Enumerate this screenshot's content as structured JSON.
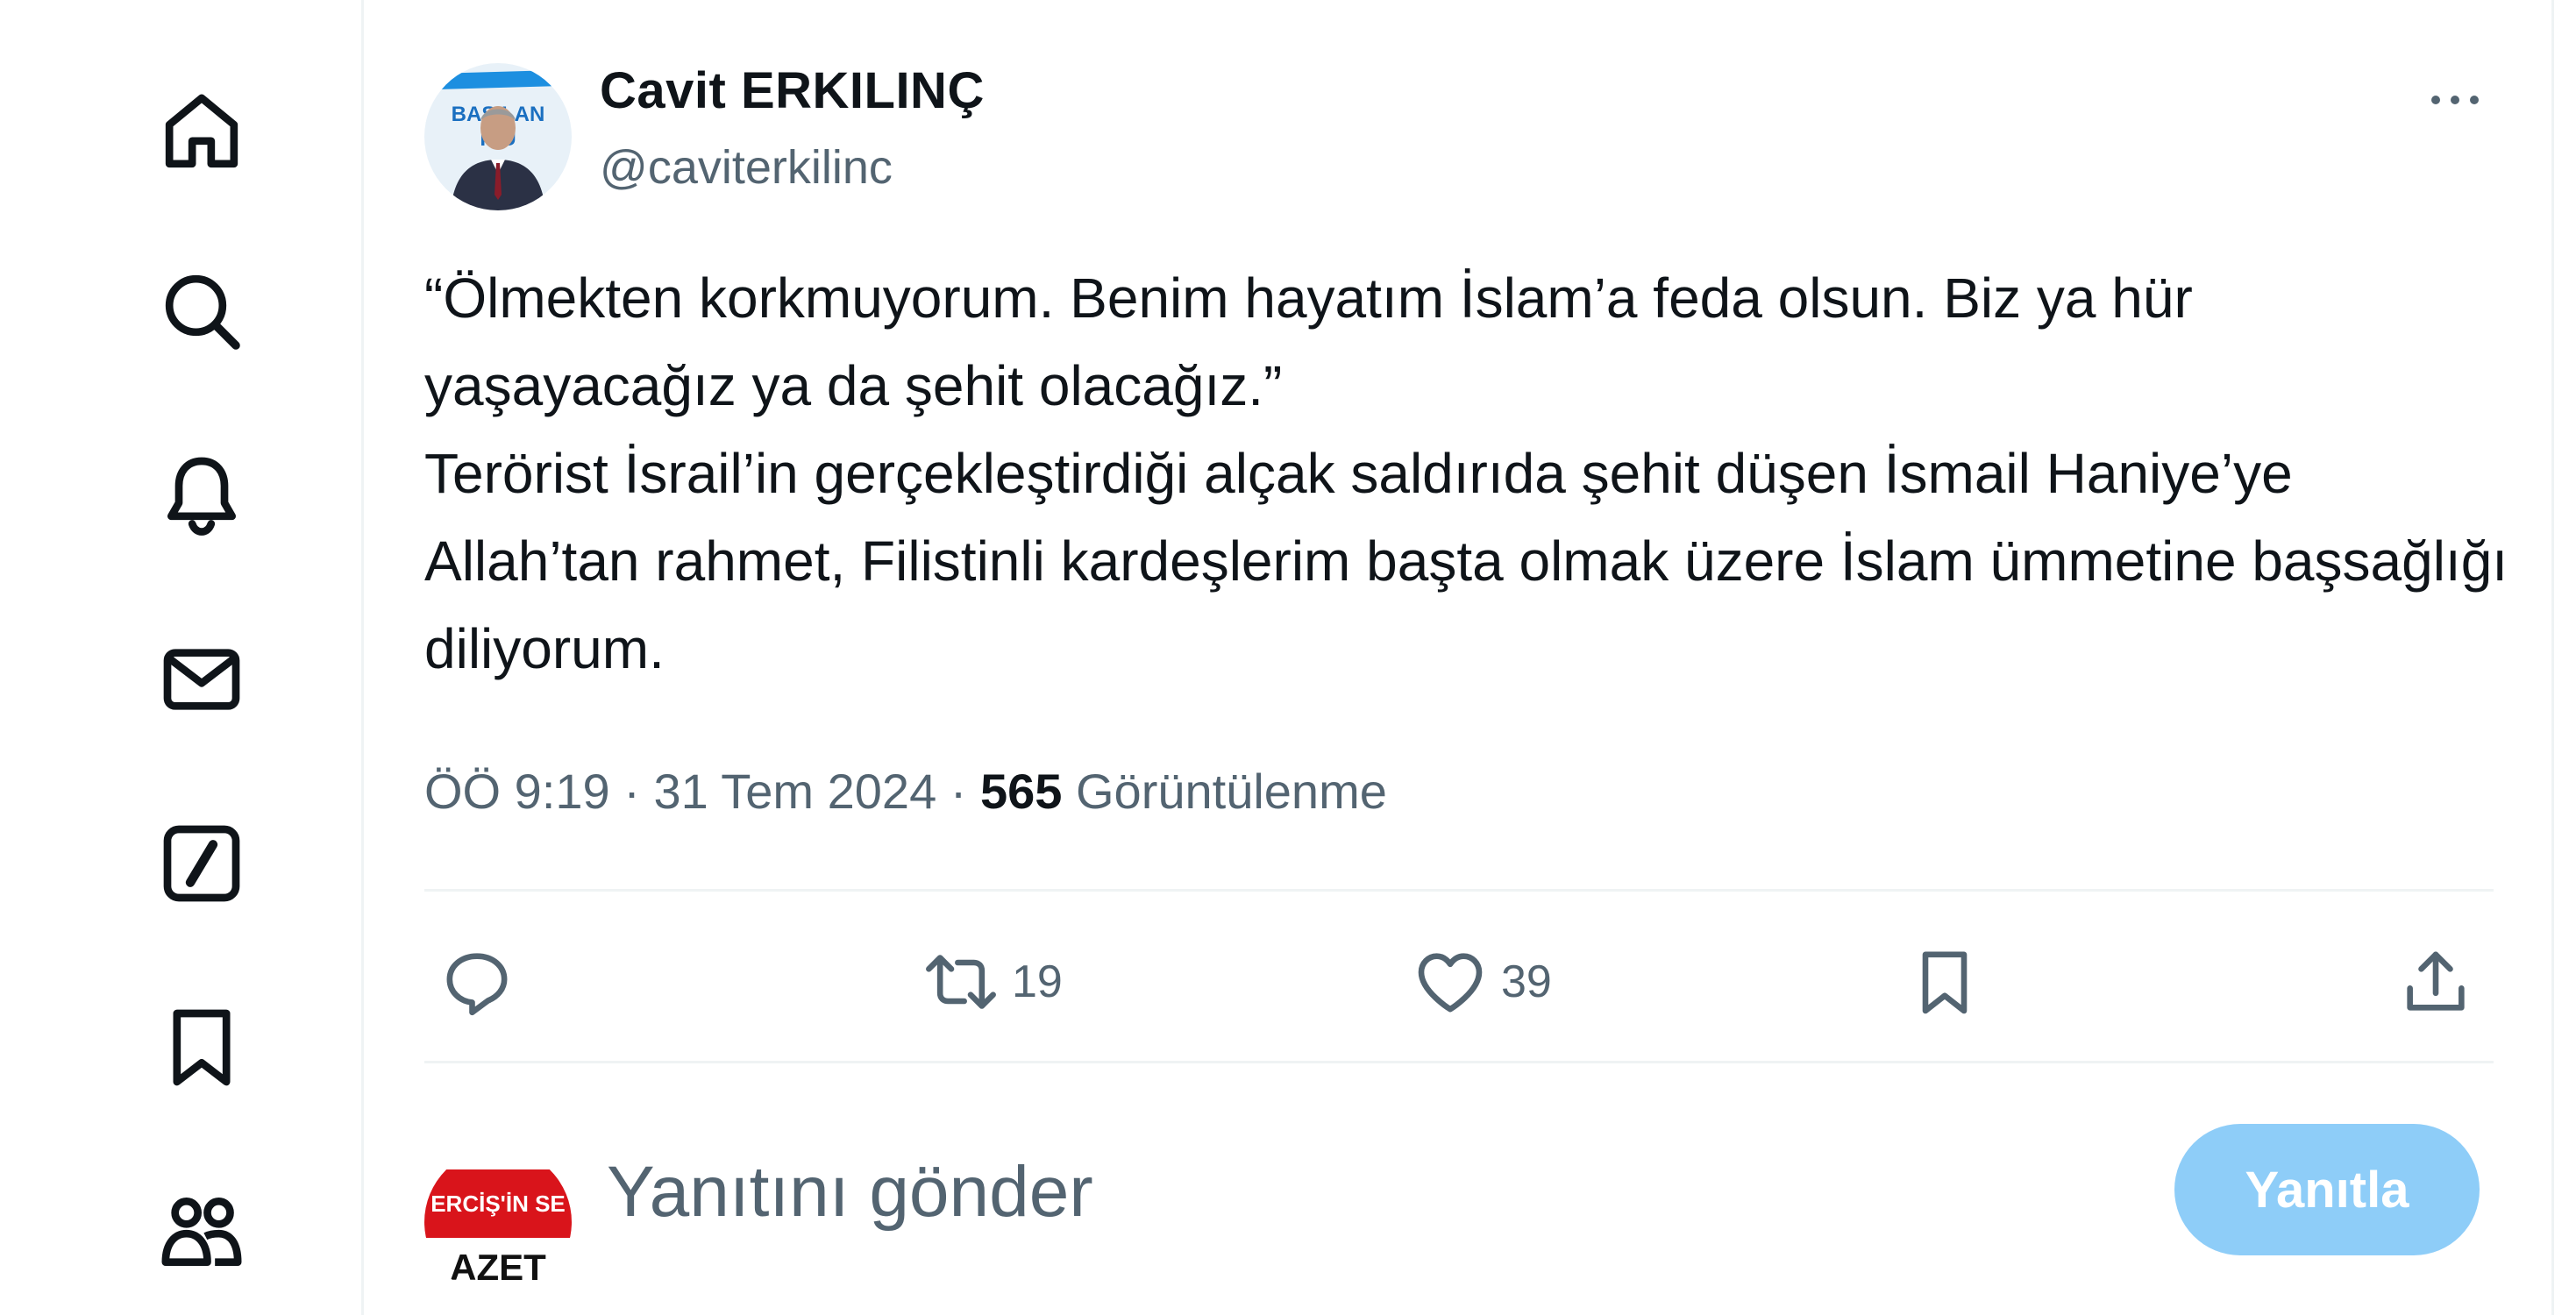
{
  "nav": {
    "items": [
      {
        "icon": "home-icon"
      },
      {
        "icon": "search-icon"
      },
      {
        "icon": "bell-icon"
      },
      {
        "icon": "mail-icon"
      },
      {
        "icon": "grok-icon"
      },
      {
        "icon": "bookmark-icon"
      },
      {
        "icon": "communities-icon"
      }
    ]
  },
  "tweet": {
    "author": {
      "name": "Cavit ERKILINÇ",
      "handle": "@caviterkilinc",
      "avatar_text_top": "BAŞ LAN",
      "avatar_text_bottom": "K U"
    },
    "text": {
      "line1": "“Ölmekten korkmuyorum. Benim hayatım İslam’a feda olsun. Biz ya hür yaşayacağız ya da şehit olacağız.”",
      "line2": "Terörist İsrail’in gerçekleştirdiği alçak saldırıda şehit düşen İsmail Haniye’ye Allah’tan rahmet, Filistinli kardeşlerim başta olmak üzere İslam ümmetine başsağlığı diliyorum."
    },
    "time": "ÖÖ 9:19",
    "separator": "·",
    "date": "31 Tem 2024",
    "views_count": "565",
    "views_label": "Görüntülenme",
    "actions": {
      "reply_count": "",
      "retweet_count": "19",
      "like_count": "39"
    }
  },
  "reply": {
    "placeholder": "Yanıtını gönder",
    "button_label": "Yanıtla",
    "avatar_text_top": "ERCİŞ'İN SE",
    "avatar_text_bottom": "AZET"
  },
  "colors": {
    "accent": "#1d9bf0",
    "reply_button": "#8ecdf8",
    "secondary_text": "#536471",
    "border": "#eff3f4"
  }
}
